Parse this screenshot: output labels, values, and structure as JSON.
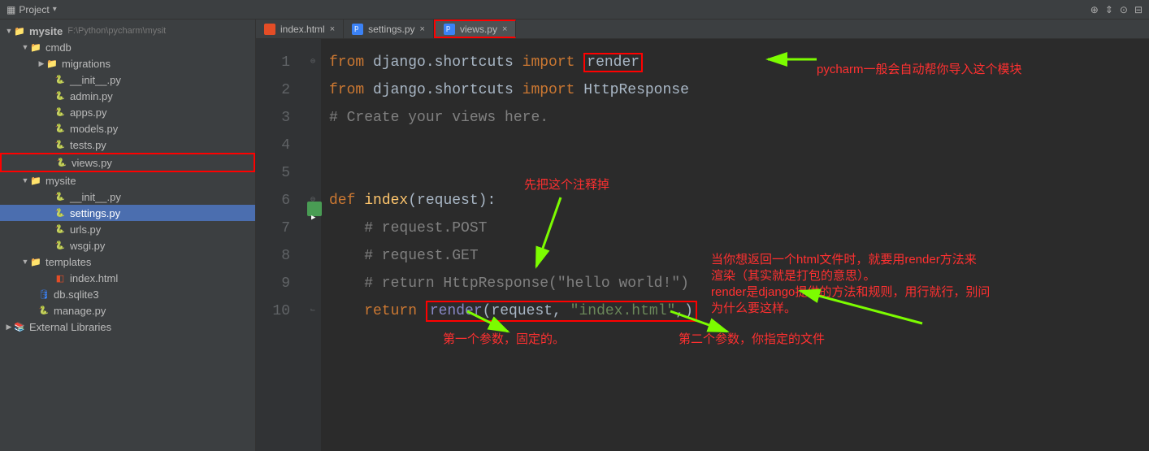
{
  "toolbar": {
    "title": "Project"
  },
  "tree": {
    "root": {
      "name": "mysite",
      "path": "F:\\Python\\pycharm\\mysit"
    },
    "cmdb": "cmdb",
    "migrations": "migrations",
    "files_cmdb": [
      "__init__.py",
      "admin.py",
      "apps.py",
      "models.py",
      "tests.py",
      "views.py"
    ],
    "mysite_inner": "mysite",
    "files_mysite": [
      "__init__.py",
      "settings.py",
      "urls.py",
      "wsgi.py"
    ],
    "templates": "templates",
    "index_html": "index.html",
    "db": "db.sqlite3",
    "manage": "manage.py",
    "ext": "External Libraries"
  },
  "tabs": [
    {
      "label": "index.html",
      "type": "html",
      "active": false
    },
    {
      "label": "settings.py",
      "type": "py",
      "active": false
    },
    {
      "label": "views.py",
      "type": "py",
      "active": true
    }
  ],
  "code": {
    "l1_from": "from",
    "l1_pkg": " django.shortcuts ",
    "l1_import": "import",
    "l1_sp": " ",
    "l1_render": "render",
    "l2_from": "from",
    "l2_pkg": " django.shortcuts ",
    "l2_import": "import",
    "l2_resp": " HttpResponse",
    "l3": "# Create your views here.",
    "l6_def": "def ",
    "l6_name": "index",
    "l6_args": "(request):",
    "l7": "    # request.POST",
    "l8": "    # request.GET",
    "l9": "    # return HttpResponse(\"hello world!\")",
    "l10_ret": "    return ",
    "l10_fn": "render",
    "l10_args1": "(request, ",
    "l10_str": "\"index.html\"",
    "l10_args2": ",)"
  },
  "line_numbers": [
    "1",
    "2",
    "3",
    "4",
    "5",
    "6",
    "7",
    "8",
    "9",
    "10"
  ],
  "annotations": {
    "a1": "pycharm一般会自动帮你导入这个模块",
    "a2": "先把这个注释掉",
    "a3a": "当你想返回一个html文件时，就要用render方法来",
    "a3b": "渲染（其实就是打包的意思）。",
    "a3c": "render是django提供的方法和规则，用行就行，别问",
    "a3d": "为什么要这样。",
    "a4": "第一个参数，固定的。",
    "a5": "第二个参数，你指定的文件"
  }
}
